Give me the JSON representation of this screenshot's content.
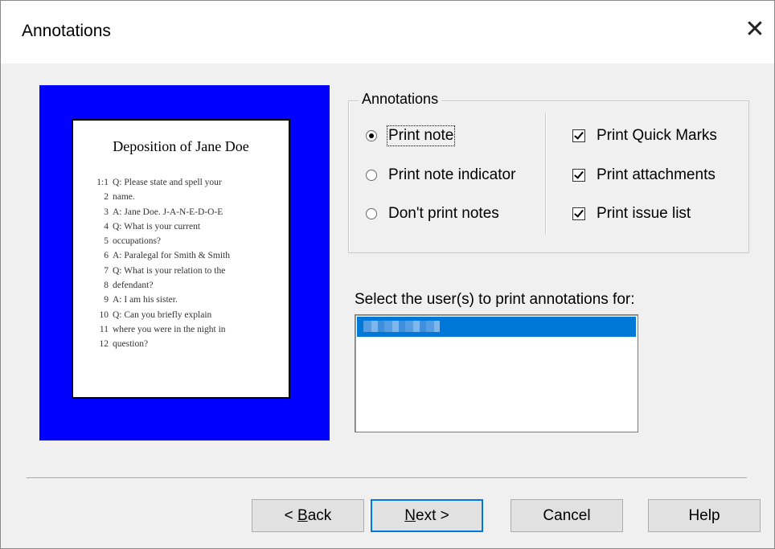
{
  "window": {
    "title": "Annotations",
    "close_glyph": "✕"
  },
  "preview": {
    "background_color": "#0000ff",
    "page_title": "Deposition of  Jane Doe",
    "lines": [
      {
        "num": "1:1",
        "text": "Q: Please state and spell your"
      },
      {
        "num": "2",
        "text": "name."
      },
      {
        "num": "3",
        "text": "A: Jane Doe. J-A-N-E-D-O-E"
      },
      {
        "num": "4",
        "text": "Q: What is your current"
      },
      {
        "num": "5",
        "text": "occupations?"
      },
      {
        "num": "6",
        "text": "A: Paralegal for Smith & Smith"
      },
      {
        "num": "7",
        "text": "Q: What is your relation to the"
      },
      {
        "num": "8",
        "text": "defendant?"
      },
      {
        "num": "9",
        "text": "A: I am his sister."
      },
      {
        "num": "10",
        "text": "Q: Can you briefly explain"
      },
      {
        "num": "11",
        "text": "where you were in the night in"
      },
      {
        "num": "12",
        "text": "question?"
      }
    ]
  },
  "annotations_group": {
    "legend": "Annotations",
    "radios": [
      {
        "label": "Print note",
        "checked": true
      },
      {
        "label": "Print note indicator",
        "checked": false
      },
      {
        "label": "Don't print notes",
        "checked": false
      }
    ],
    "checkboxes": [
      {
        "label": "Print Quick Marks",
        "checked": true
      },
      {
        "label": "Print attachments",
        "checked": true
      },
      {
        "label": "Print issue list",
        "checked": true
      }
    ]
  },
  "users": {
    "label": "Select the user(s) to print annotations for:",
    "selection_color": "#0078d7"
  },
  "buttons": {
    "back_mnemonic": "B",
    "back_rest": "ack",
    "back_prefix": "< ",
    "next_mnemonic": "N",
    "next_rest": "ext >",
    "cancel": "Cancel",
    "help": "Help"
  }
}
